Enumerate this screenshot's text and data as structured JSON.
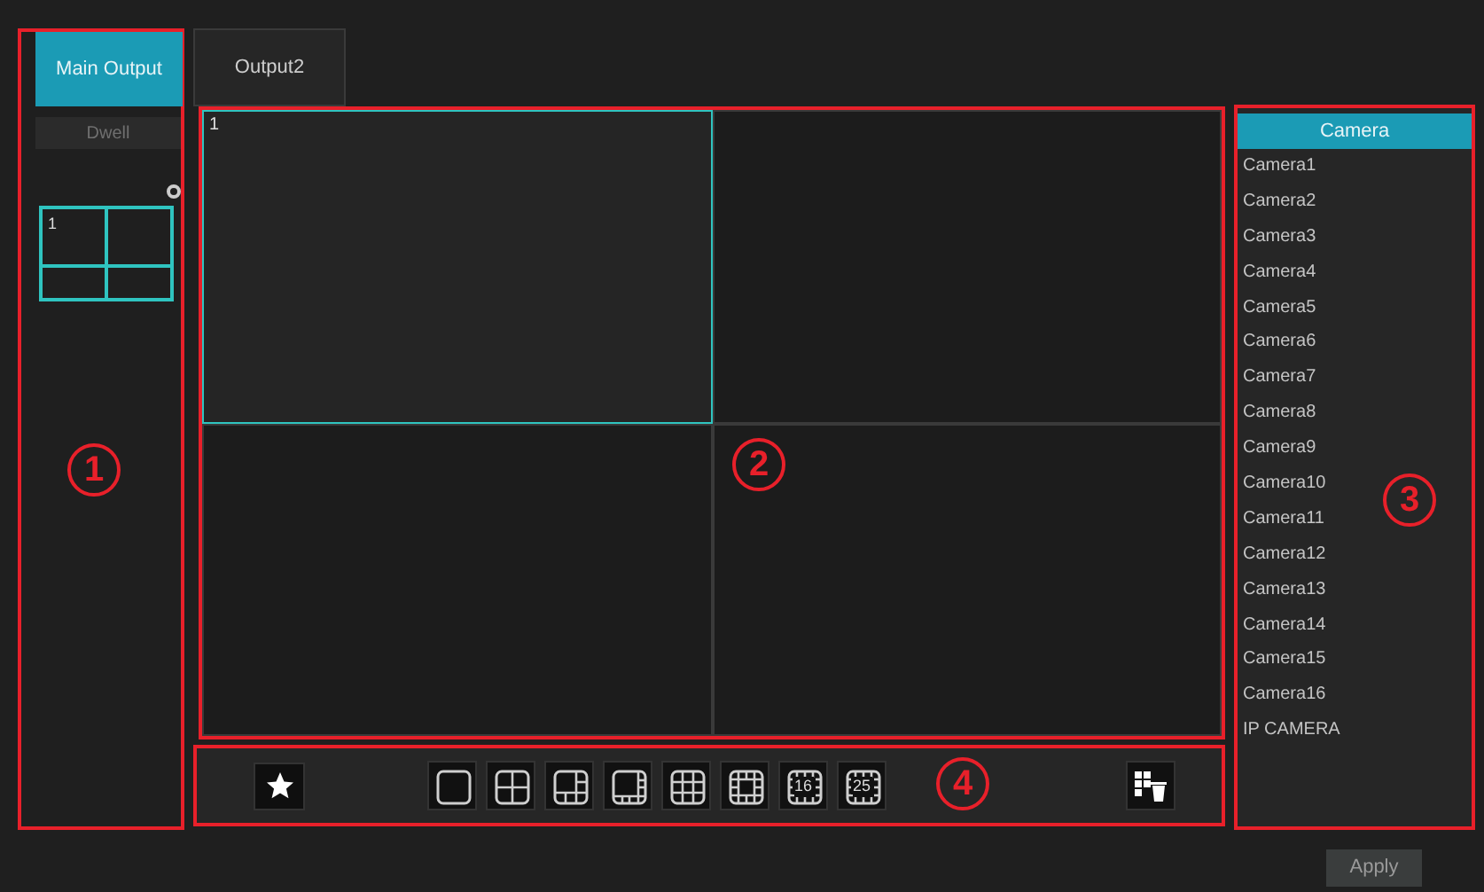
{
  "tabs": [
    {
      "label": "Main Output",
      "selected": true
    },
    {
      "label": "Output2",
      "selected": false
    }
  ],
  "dwell": {
    "label": "Dwell"
  },
  "preview": {
    "label": "1"
  },
  "view_grid": {
    "cells": [
      {
        "label": "1",
        "selected": true
      },
      {
        "selected": false
      },
      {
        "selected": false
      },
      {
        "selected": false
      }
    ]
  },
  "camera_list": {
    "title": "Camera",
    "items": [
      "Camera1",
      "Camera2",
      "Camera3",
      "Camera4",
      "Camera5",
      "Camera6",
      "Camera7",
      "Camera8",
      "Camera9",
      "Camera10",
      "Camera11",
      "Camera12",
      "Camera13",
      "Camera14",
      "Camera15",
      "Camera16",
      "IP CAMERA"
    ]
  },
  "toolbar": {
    "layouts": [
      {
        "kind": "single"
      },
      {
        "kind": "quad"
      },
      {
        "kind": "six"
      },
      {
        "kind": "eight"
      },
      {
        "kind": "nine"
      },
      {
        "kind": "thirteen"
      },
      {
        "kind": "grid",
        "label": "16"
      },
      {
        "kind": "grid",
        "label": "25"
      }
    ]
  },
  "apply": "Apply",
  "annotations": [
    {
      "label": "1"
    },
    {
      "label": "2"
    },
    {
      "label": "3"
    },
    {
      "label": "4"
    }
  ]
}
